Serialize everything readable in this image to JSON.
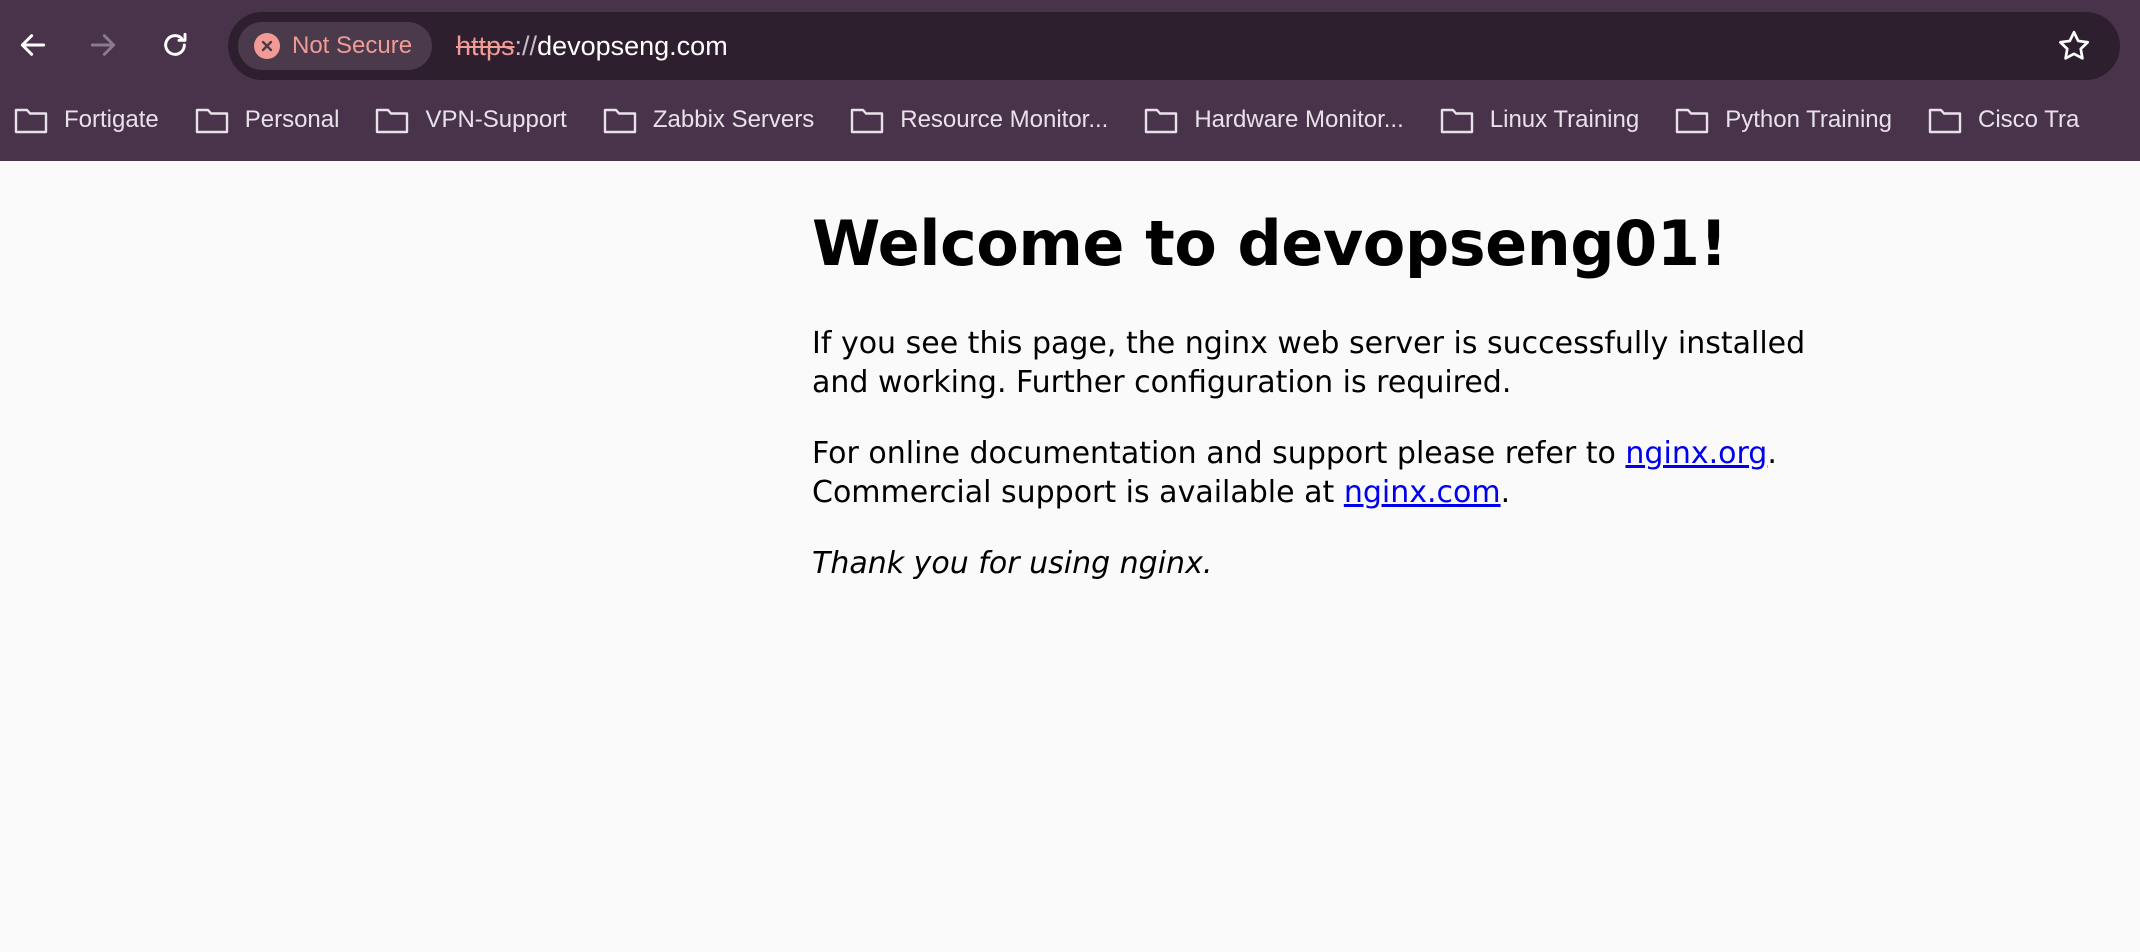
{
  "browser": {
    "security_label": "Not Secure",
    "url_scheme": "https",
    "url_separator": "://",
    "url_host": "devopseng.com",
    "accent_color": "#f29b95",
    "toolbar_color": "#48334a"
  },
  "bookmarks": [
    {
      "label": "Fortigate"
    },
    {
      "label": "Personal"
    },
    {
      "label": "VPN-Support"
    },
    {
      "label": "Zabbix Servers"
    },
    {
      "label": "Resource Monitor..."
    },
    {
      "label": "Hardware Monitor..."
    },
    {
      "label": "Linux Training"
    },
    {
      "label": "Python Training"
    },
    {
      "label": "Cisco Tra"
    }
  ],
  "page": {
    "heading": "Welcome to devopseng01!",
    "para1": "If you see this page, the nginx web server is successfully installed and working. Further configuration is required.",
    "para2_prefix": "For online documentation and support please refer to ",
    "link_org": "nginx.org",
    "para2_mid": ".",
    "para2_line2": "Commercial support is available at ",
    "link_com": "nginx.com",
    "para2_end": ".",
    "thanks": "Thank you for using nginx."
  }
}
